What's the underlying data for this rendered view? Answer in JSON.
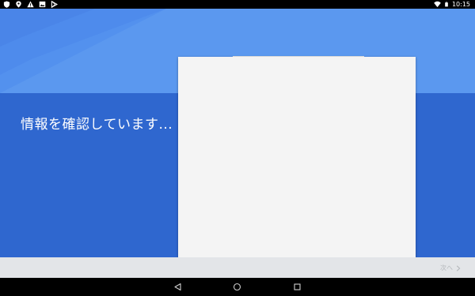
{
  "status_bar": {
    "time": "10:15",
    "left_icons": [
      "shield-icon",
      "location-icon",
      "warning-icon",
      "image-icon",
      "play-store-icon"
    ],
    "right_icons": [
      "wifi-icon",
      "battery-icon"
    ]
  },
  "setup": {
    "status_title": "情報を確認しています..."
  },
  "bottom_bar": {
    "next_label": "次へ"
  },
  "system_nav": {
    "buttons": [
      "back",
      "home",
      "recents"
    ]
  },
  "colors": {
    "header": "#5b98ef",
    "main": "#2f67cf",
    "card": "#f4f4f4",
    "bottom_bar": "#e3e5e8",
    "next_text": "#b5b8bc"
  }
}
